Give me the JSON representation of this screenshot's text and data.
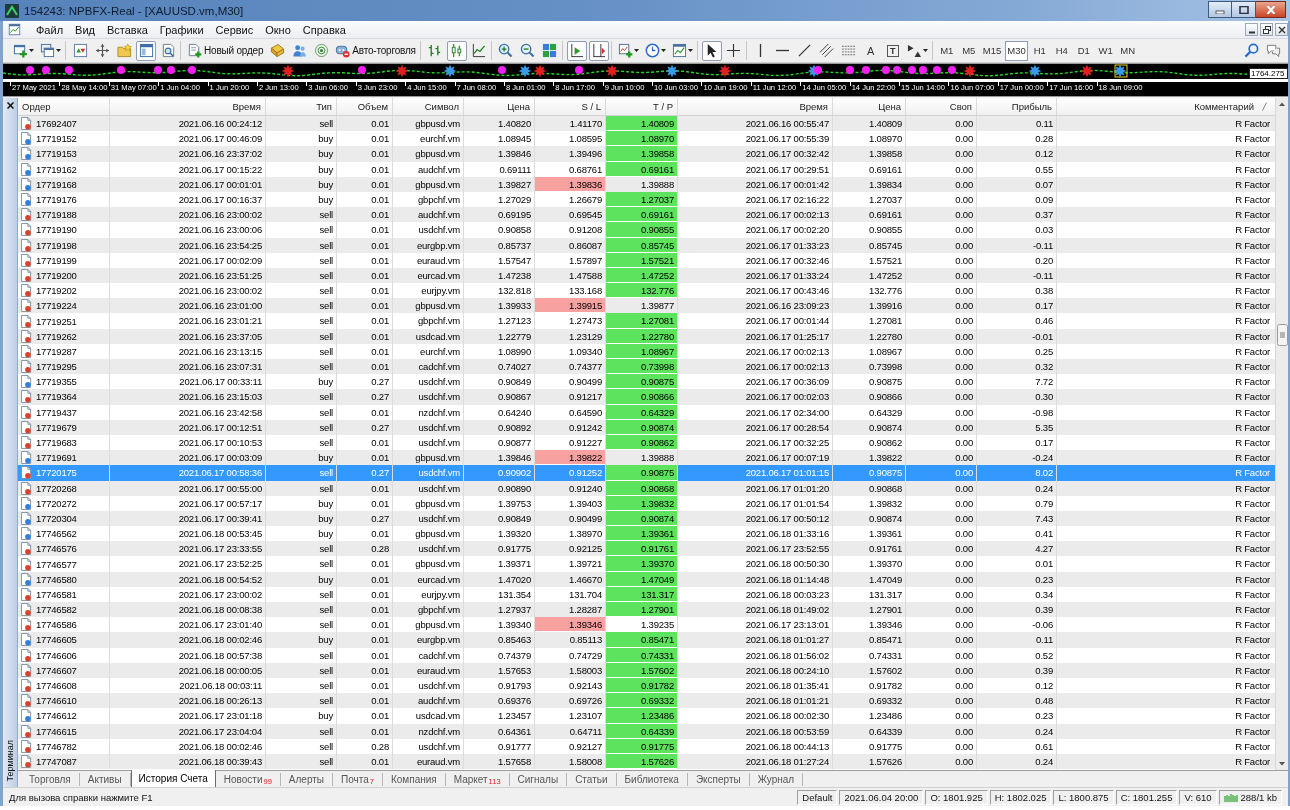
{
  "window": {
    "title": "154243: NPBFX-Real - [XAUUSD.vm,M30]"
  },
  "menu": [
    "Файл",
    "Вид",
    "Вставка",
    "Графики",
    "Сервис",
    "Окно",
    "Справка"
  ],
  "toolbar": {
    "groups": [
      [
        {
          "kind": "icon",
          "pressed": false,
          "dropdown": true
        },
        {
          "kind": "icon",
          "pressed": false,
          "dropdown": true
        }
      ],
      [
        {
          "kind": "icon",
          "pressed": false
        },
        {
          "kind": "icon",
          "pressed": false
        },
        {
          "kind": "icon",
          "pressed": false
        },
        {
          "kind": "icon",
          "pressed": true
        },
        {
          "kind": "icon",
          "pressed": false
        }
      ],
      [
        {
          "kind": "button",
          "label": "Новый ордер",
          "pressed": false
        },
        {
          "kind": "icon",
          "pressed": false
        },
        {
          "kind": "icon",
          "pressed": false
        },
        {
          "kind": "icon",
          "pressed": false
        },
        {
          "kind": "button",
          "label": "Авто-торговля",
          "pressed": false
        }
      ],
      [
        {
          "kind": "icon",
          "pressed": false
        },
        {
          "kind": "icon",
          "pressed": true
        },
        {
          "kind": "icon",
          "pressed": false
        }
      ],
      [
        {
          "kind": "icon",
          "pressed": false
        },
        {
          "kind": "icon",
          "pressed": false
        },
        {
          "kind": "icon",
          "pressed": false
        }
      ],
      [
        {
          "kind": "icon",
          "pressed": true
        },
        {
          "kind": "icon",
          "pressed": true
        }
      ],
      [
        {
          "kind": "icon",
          "pressed": false,
          "dropdown": true
        },
        {
          "kind": "icon",
          "pressed": false,
          "dropdown": true
        },
        {
          "kind": "icon",
          "pressed": false,
          "dropdown": true
        }
      ],
      [
        {
          "kind": "icon",
          "pressed": true
        },
        {
          "kind": "icon",
          "pressed": false
        }
      ],
      [
        {
          "kind": "icon",
          "pressed": false
        },
        {
          "kind": "icon",
          "pressed": false
        },
        {
          "kind": "icon",
          "pressed": false
        },
        {
          "kind": "icon",
          "pressed": false
        },
        {
          "kind": "icon",
          "pressed": false
        },
        {
          "kind": "glyph",
          "label": "A",
          "pressed": false
        },
        {
          "kind": "boxed_glyph",
          "label": "T",
          "pressed": false
        },
        {
          "kind": "icon",
          "pressed": false,
          "dropdown": true
        }
      ],
      [
        {
          "kind": "period",
          "label": "M1",
          "selected": false
        },
        {
          "kind": "period",
          "label": "M5",
          "selected": false
        },
        {
          "kind": "period",
          "label": "M15",
          "selected": false
        },
        {
          "kind": "period",
          "label": "M30",
          "selected": true
        },
        {
          "kind": "period",
          "label": "H1",
          "selected": false
        },
        {
          "kind": "period",
          "label": "H4",
          "selected": false
        },
        {
          "kind": "period",
          "label": "D1",
          "selected": false
        },
        {
          "kind": "period",
          "label": "W1",
          "selected": false
        },
        {
          "kind": "period",
          "label": "MN",
          "selected": false
        }
      ]
    ]
  },
  "chart": {
    "price_label": "1764.275",
    "time_labels": [
      "27 May 2021",
      "28 May 14:00",
      "31 May 07:00",
      "1 Jun 04:00",
      "1 Jun 20:00",
      "2 Jun 13:00",
      "3 Jun 06:00",
      "3 Jun 23:00",
      "4 Jun 15:00",
      "7 Jun 08:00",
      "8 Jun 01:00",
      "8 Jun 17:00",
      "9 Jun 10:00",
      "10 Jun 03:00",
      "10 Jun 19:00",
      "11 Jun 12:00",
      "14 Jun 05:00",
      "14 Jun 22:00",
      "15 Jun 14:00",
      "16 Jun 07:00",
      "17 Jun 00:00",
      "17 Jun 16:00",
      "18 Jun 09:00"
    ]
  },
  "terminal": {
    "caption": "Терминал",
    "columns": [
      "Ордер",
      "Время",
      "Тип",
      "Объем",
      "Символ",
      "Цена",
      "S / L",
      "T / P",
      "Время",
      "Цена",
      "Своп",
      "Прибыль",
      "Комментарий"
    ],
    "rows": [
      {
        "kind": "sell",
        "selected": false,
        "sl_hit": false,
        "tp_hit": true,
        "cells": [
          "17692407",
          "2021.06.16 00:24:12",
          "sell",
          "0.01",
          "gbpusd.vm",
          "1.40820",
          "1.41170",
          "1.40809",
          "2021.06.16 00:55:47",
          "1.40809",
          "0.00",
          "0.11",
          "R Factor"
        ]
      },
      {
        "kind": "buy",
        "selected": false,
        "sl_hit": false,
        "tp_hit": true,
        "cells": [
          "17719152",
          "2021.06.17 00:46:09",
          "buy",
          "0.01",
          "eurchf.vm",
          "1.08945",
          "1.08595",
          "1.08970",
          "2021.06.17 00:55:39",
          "1.08970",
          "0.00",
          "0.28",
          "R Factor"
        ]
      },
      {
        "kind": "buy",
        "selected": false,
        "sl_hit": false,
        "tp_hit": true,
        "cells": [
          "17719153",
          "2021.06.16 23:37:02",
          "buy",
          "0.01",
          "gbpusd.vm",
          "1.39846",
          "1.39496",
          "1.39858",
          "2021.06.17 00:32:42",
          "1.39858",
          "0.00",
          "0.12",
          "R Factor"
        ]
      },
      {
        "kind": "buy",
        "selected": false,
        "sl_hit": false,
        "tp_hit": true,
        "cells": [
          "17719162",
          "2021.06.17 00:15:22",
          "buy",
          "0.01",
          "audchf.vm",
          "0.69111",
          "0.68761",
          "0.69161",
          "2021.06.17 00:29:51",
          "0.69161",
          "0.00",
          "0.55",
          "R Factor"
        ]
      },
      {
        "kind": "buy",
        "selected": false,
        "sl_hit": true,
        "tp_hit": false,
        "cells": [
          "17719168",
          "2021.06.17 00:01:01",
          "buy",
          "0.01",
          "gbpusd.vm",
          "1.39827",
          "1.39836",
          "1.39888",
          "2021.06.17 00:01:42",
          "1.39834",
          "0.00",
          "0.07",
          "R Factor"
        ]
      },
      {
        "kind": "buy",
        "selected": false,
        "sl_hit": false,
        "tp_hit": true,
        "cells": [
          "17719176",
          "2021.06.17 00:16:37",
          "buy",
          "0.01",
          "gbpchf.vm",
          "1.27029",
          "1.26679",
          "1.27037",
          "2021.06.17 02:16:22",
          "1.27037",
          "0.00",
          "0.09",
          "R Factor"
        ]
      },
      {
        "kind": "sell",
        "selected": false,
        "sl_hit": false,
        "tp_hit": true,
        "cells": [
          "17719188",
          "2021.06.16 23:00:02",
          "sell",
          "0.01",
          "audchf.vm",
          "0.69195",
          "0.69545",
          "0.69161",
          "2021.06.17 00:02:13",
          "0.69161",
          "0.00",
          "0.37",
          "R Factor"
        ]
      },
      {
        "kind": "sell",
        "selected": false,
        "sl_hit": false,
        "tp_hit": true,
        "cells": [
          "17719190",
          "2021.06.16 23:00:06",
          "sell",
          "0.01",
          "usdchf.vm",
          "0.90858",
          "0.91208",
          "0.90855",
          "2021.06.17 00:02:20",
          "0.90855",
          "0.00",
          "0.03",
          "R Factor"
        ]
      },
      {
        "kind": "sell",
        "selected": false,
        "sl_hit": false,
        "tp_hit": true,
        "cells": [
          "17719198",
          "2021.06.16 23:54:25",
          "sell",
          "0.01",
          "eurgbp.vm",
          "0.85737",
          "0.86087",
          "0.85745",
          "2021.06.17 01:33:23",
          "0.85745",
          "0.00",
          "-0.11",
          "R Factor"
        ]
      },
      {
        "kind": "sell",
        "selected": false,
        "sl_hit": false,
        "tp_hit": true,
        "cells": [
          "17719199",
          "2021.06.17 00:02:09",
          "sell",
          "0.01",
          "euraud.vm",
          "1.57547",
          "1.57897",
          "1.57521",
          "2021.06.17 00:32:46",
          "1.57521",
          "0.00",
          "0.20",
          "R Factor"
        ]
      },
      {
        "kind": "sell",
        "selected": false,
        "sl_hit": false,
        "tp_hit": true,
        "cells": [
          "17719200",
          "2021.06.16 23:51:25",
          "sell",
          "0.01",
          "eurcad.vm",
          "1.47238",
          "1.47588",
          "1.47252",
          "2021.06.17 01:33:24",
          "1.47252",
          "0.00",
          "-0.11",
          "R Factor"
        ]
      },
      {
        "kind": "sell",
        "selected": false,
        "sl_hit": false,
        "tp_hit": true,
        "cells": [
          "17719202",
          "2021.06.16 23:00:02",
          "sell",
          "0.01",
          "eurjpy.vm",
          "132.818",
          "133.168",
          "132.776",
          "2021.06.17 00:43:46",
          "132.776",
          "0.00",
          "0.38",
          "R Factor"
        ]
      },
      {
        "kind": "sell",
        "selected": false,
        "sl_hit": true,
        "tp_hit": false,
        "cells": [
          "17719224",
          "2021.06.16 23:01:00",
          "sell",
          "0.01",
          "gbpusd.vm",
          "1.39933",
          "1.39915",
          "1.39877",
          "2021.06.16 23:09:23",
          "1.39916",
          "0.00",
          "0.17",
          "R Factor"
        ]
      },
      {
        "kind": "sell",
        "selected": false,
        "sl_hit": false,
        "tp_hit": true,
        "cells": [
          "17719251",
          "2021.06.16 23:01:21",
          "sell",
          "0.01",
          "gbpchf.vm",
          "1.27123",
          "1.27473",
          "1.27081",
          "2021.06.17 00:01:44",
          "1.27081",
          "0.00",
          "0.46",
          "R Factor"
        ]
      },
      {
        "kind": "sell",
        "selected": false,
        "sl_hit": false,
        "tp_hit": true,
        "cells": [
          "17719262",
          "2021.06.16 23:37:05",
          "sell",
          "0.01",
          "usdcad.vm",
          "1.22779",
          "1.23129",
          "1.22780",
          "2021.06.17 01:25:17",
          "1.22780",
          "0.00",
          "-0.01",
          "R Factor"
        ]
      },
      {
        "kind": "sell",
        "selected": false,
        "sl_hit": false,
        "tp_hit": true,
        "cells": [
          "17719287",
          "2021.06.16 23:13:15",
          "sell",
          "0.01",
          "eurchf.vm",
          "1.08990",
          "1.09340",
          "1.08967",
          "2021.06.17 00:02:13",
          "1.08967",
          "0.00",
          "0.25",
          "R Factor"
        ]
      },
      {
        "kind": "sell",
        "selected": false,
        "sl_hit": false,
        "tp_hit": true,
        "cells": [
          "17719295",
          "2021.06.16 23:07:31",
          "sell",
          "0.01",
          "cadchf.vm",
          "0.74027",
          "0.74377",
          "0.73998",
          "2021.06.17 00:02:13",
          "0.73998",
          "0.00",
          "0.32",
          "R Factor"
        ]
      },
      {
        "kind": "buy",
        "selected": false,
        "sl_hit": false,
        "tp_hit": true,
        "cells": [
          "17719355",
          "2021.06.17 00:33:11",
          "buy",
          "0.27",
          "usdchf.vm",
          "0.90849",
          "0.90499",
          "0.90875",
          "2021.06.17 00:36:09",
          "0.90875",
          "0.00",
          "7.72",
          "R Factor"
        ]
      },
      {
        "kind": "sell",
        "selected": false,
        "sl_hit": false,
        "tp_hit": true,
        "cells": [
          "17719364",
          "2021.06.16 23:15:03",
          "sell",
          "0.27",
          "usdchf.vm",
          "0.90867",
          "0.91217",
          "0.90866",
          "2021.06.17 00:02:03",
          "0.90866",
          "0.00",
          "0.30",
          "R Factor"
        ]
      },
      {
        "kind": "sell",
        "selected": false,
        "sl_hit": false,
        "tp_hit": true,
        "cells": [
          "17719437",
          "2021.06.16 23:42:58",
          "sell",
          "0.01",
          "nzdchf.vm",
          "0.64240",
          "0.64590",
          "0.64329",
          "2021.06.17 02:34:00",
          "0.64329",
          "0.00",
          "-0.98",
          "R Factor"
        ]
      },
      {
        "kind": "sell",
        "selected": false,
        "sl_hit": false,
        "tp_hit": true,
        "cells": [
          "17719679",
          "2021.06.17 00:12:51",
          "sell",
          "0.27",
          "usdchf.vm",
          "0.90892",
          "0.91242",
          "0.90874",
          "2021.06.17 00:28:54",
          "0.90874",
          "0.00",
          "5.35",
          "R Factor"
        ]
      },
      {
        "kind": "sell",
        "selected": false,
        "sl_hit": false,
        "tp_hit": true,
        "cells": [
          "17719683",
          "2021.06.17 00:10:53",
          "sell",
          "0.01",
          "usdchf.vm",
          "0.90877",
          "0.91227",
          "0.90862",
          "2021.06.17 00:32:25",
          "0.90862",
          "0.00",
          "0.17",
          "R Factor"
        ]
      },
      {
        "kind": "buy",
        "selected": false,
        "sl_hit": true,
        "tp_hit": false,
        "cells": [
          "17719691",
          "2021.06.17 00:03:09",
          "buy",
          "0.01",
          "gbpusd.vm",
          "1.39846",
          "1.39822",
          "1.39888",
          "2021.06.17 00:07:19",
          "1.39822",
          "0.00",
          "-0.24",
          "R Factor"
        ]
      },
      {
        "kind": "sell",
        "selected": true,
        "sl_hit": false,
        "tp_hit": true,
        "cells": [
          "17720175",
          "2021.06.17 00:58:36",
          "sell",
          "0.27",
          "usdchf.vm",
          "0.90902",
          "0.91252",
          "0.90875",
          "2021.06.17 01:01:15",
          "0.90875",
          "0.00",
          "8.02",
          "R Factor"
        ]
      },
      {
        "kind": "sell",
        "selected": false,
        "sl_hit": false,
        "tp_hit": true,
        "cells": [
          "17720268",
          "2021.06.17 00:55:00",
          "sell",
          "0.01",
          "usdchf.vm",
          "0.90890",
          "0.91240",
          "0.90868",
          "2021.06.17 01:01:20",
          "0.90868",
          "0.00",
          "0.24",
          "R Factor"
        ]
      },
      {
        "kind": "buy",
        "selected": false,
        "sl_hit": false,
        "tp_hit": true,
        "cells": [
          "17720272",
          "2021.06.17 00:57:17",
          "buy",
          "0.01",
          "gbpusd.vm",
          "1.39753",
          "1.39403",
          "1.39832",
          "2021.06.17 01:01:54",
          "1.39832",
          "0.00",
          "0.79",
          "R Factor"
        ]
      },
      {
        "kind": "buy",
        "selected": false,
        "sl_hit": false,
        "tp_hit": true,
        "cells": [
          "17720304",
          "2021.06.17 00:39:41",
          "buy",
          "0.27",
          "usdchf.vm",
          "0.90849",
          "0.90499",
          "0.90874",
          "2021.06.17 00:50:12",
          "0.90874",
          "0.00",
          "7.43",
          "R Factor"
        ]
      },
      {
        "kind": "buy",
        "selected": false,
        "sl_hit": false,
        "tp_hit": true,
        "cells": [
          "17746562",
          "2021.06.18 00:53:45",
          "buy",
          "0.01",
          "gbpusd.vm",
          "1.39320",
          "1.38970",
          "1.39361",
          "2021.06.18 01:33:16",
          "1.39361",
          "0.00",
          "0.41",
          "R Factor"
        ]
      },
      {
        "kind": "sell",
        "selected": false,
        "sl_hit": false,
        "tp_hit": true,
        "cells": [
          "17746576",
          "2021.06.17 23:33:55",
          "sell",
          "0.28",
          "usdchf.vm",
          "0.91775",
          "0.92125",
          "0.91761",
          "2021.06.17 23:52:55",
          "0.91761",
          "0.00",
          "4.27",
          "R Factor"
        ]
      },
      {
        "kind": "sell",
        "selected": false,
        "sl_hit": false,
        "tp_hit": true,
        "cells": [
          "17746577",
          "2021.06.17 23:52:25",
          "sell",
          "0.01",
          "gbpusd.vm",
          "1.39371",
          "1.39721",
          "1.39370",
          "2021.06.18 00:50:30",
          "1.39370",
          "0.00",
          "0.01",
          "R Factor"
        ]
      },
      {
        "kind": "buy",
        "selected": false,
        "sl_hit": false,
        "tp_hit": true,
        "cells": [
          "17746580",
          "2021.06.18 00:54:52",
          "buy",
          "0.01",
          "eurcad.vm",
          "1.47020",
          "1.46670",
          "1.47049",
          "2021.06.18 01:14:48",
          "1.47049",
          "0.00",
          "0.23",
          "R Factor"
        ]
      },
      {
        "kind": "sell",
        "selected": false,
        "sl_hit": false,
        "tp_hit": true,
        "cells": [
          "17746581",
          "2021.06.17 23:00:02",
          "sell",
          "0.01",
          "eurjpy.vm",
          "131.354",
          "131.704",
          "131.317",
          "2021.06.18 00:03:23",
          "131.317",
          "0.00",
          "0.34",
          "R Factor"
        ]
      },
      {
        "kind": "sell",
        "selected": false,
        "sl_hit": false,
        "tp_hit": true,
        "cells": [
          "17746582",
          "2021.06.18 00:08:38",
          "sell",
          "0.01",
          "gbpchf.vm",
          "1.27937",
          "1.28287",
          "1.27901",
          "2021.06.18 01:49:02",
          "1.27901",
          "0.00",
          "0.39",
          "R Factor"
        ]
      },
      {
        "kind": "sell",
        "selected": false,
        "sl_hit": true,
        "tp_hit": false,
        "cells": [
          "17746586",
          "2021.06.17 23:01:40",
          "sell",
          "0.01",
          "gbpusd.vm",
          "1.39340",
          "1.39346",
          "1.39235",
          "2021.06.17 23:13:01",
          "1.39346",
          "0.00",
          "-0.06",
          "R Factor"
        ]
      },
      {
        "kind": "buy",
        "selected": false,
        "sl_hit": false,
        "tp_hit": true,
        "cells": [
          "17746605",
          "2021.06.18 00:02:46",
          "buy",
          "0.01",
          "eurgbp.vm",
          "0.85463",
          "0.85113",
          "0.85471",
          "2021.06.18 01:01:27",
          "0.85471",
          "0.00",
          "0.11",
          "R Factor"
        ]
      },
      {
        "kind": "sell",
        "selected": false,
        "sl_hit": false,
        "tp_hit": true,
        "cells": [
          "17746606",
          "2021.06.18 00:57:38",
          "sell",
          "0.01",
          "cadchf.vm",
          "0.74379",
          "0.74729",
          "0.74331",
          "2021.06.18 01:56:02",
          "0.74331",
          "0.00",
          "0.52",
          "R Factor"
        ]
      },
      {
        "kind": "sell",
        "selected": false,
        "sl_hit": false,
        "tp_hit": true,
        "cells": [
          "17746607",
          "2021.06.18 00:00:05",
          "sell",
          "0.01",
          "euraud.vm",
          "1.57653",
          "1.58003",
          "1.57602",
          "2021.06.18 00:24:10",
          "1.57602",
          "0.00",
          "0.39",
          "R Factor"
        ]
      },
      {
        "kind": "sell",
        "selected": false,
        "sl_hit": false,
        "tp_hit": true,
        "cells": [
          "17746608",
          "2021.06.18 00:03:11",
          "sell",
          "0.01",
          "usdchf.vm",
          "0.91793",
          "0.92143",
          "0.91782",
          "2021.06.18 01:35:41",
          "0.91782",
          "0.00",
          "0.12",
          "R Factor"
        ]
      },
      {
        "kind": "sell",
        "selected": false,
        "sl_hit": false,
        "tp_hit": true,
        "cells": [
          "17746610",
          "2021.06.18 00:26:13",
          "sell",
          "0.01",
          "audchf.vm",
          "0.69376",
          "0.69726",
          "0.69332",
          "2021.06.18 01:01:21",
          "0.69332",
          "0.00",
          "0.48",
          "R Factor"
        ]
      },
      {
        "kind": "buy",
        "selected": false,
        "sl_hit": false,
        "tp_hit": true,
        "cells": [
          "17746612",
          "2021.06.17 23:01:18",
          "buy",
          "0.01",
          "usdcad.vm",
          "1.23457",
          "1.23107",
          "1.23486",
          "2021.06.18 00:02:30",
          "1.23486",
          "0.00",
          "0.23",
          "R Factor"
        ]
      },
      {
        "kind": "sell",
        "selected": false,
        "sl_hit": false,
        "tp_hit": true,
        "cells": [
          "17746615",
          "2021.06.17 23:04:04",
          "sell",
          "0.01",
          "nzdchf.vm",
          "0.64361",
          "0.64711",
          "0.64339",
          "2021.06.18 00:53:59",
          "0.64339",
          "0.00",
          "0.24",
          "R Factor"
        ]
      },
      {
        "kind": "sell",
        "selected": false,
        "sl_hit": false,
        "tp_hit": true,
        "cells": [
          "17746782",
          "2021.06.18 00:02:46",
          "sell",
          "0.28",
          "usdchf.vm",
          "0.91777",
          "0.92127",
          "0.91775",
          "2021.06.18 00:44:13",
          "0.91775",
          "0.00",
          "0.61",
          "R Factor"
        ]
      },
      {
        "kind": "sell",
        "selected": false,
        "sl_hit": false,
        "tp_hit": true,
        "cells": [
          "17747087",
          "2021.06.18 00:39:43",
          "sell",
          "0.01",
          "euraud.vm",
          "1.57658",
          "1.58008",
          "1.57626",
          "2021.06.18 01:27:24",
          "1.57626",
          "0.00",
          "0.24",
          "R Factor"
        ]
      }
    ],
    "tabs": [
      {
        "label": "Торговля",
        "selected": false
      },
      {
        "label": "Активы",
        "selected": false
      },
      {
        "label": "История Счета",
        "selected": true
      },
      {
        "label": "Новости",
        "badge": "99",
        "selected": false
      },
      {
        "label": "Алерты",
        "selected": false
      },
      {
        "label": "Почта",
        "badge": "7",
        "selected": false
      },
      {
        "label": "Компания",
        "selected": false
      },
      {
        "label": "Маркет",
        "badge": "113",
        "selected": false
      },
      {
        "label": "Сигналы",
        "selected": false
      },
      {
        "label": "Статьи",
        "selected": false
      },
      {
        "label": "Библиотека",
        "selected": false
      },
      {
        "label": "Эксперты",
        "selected": false
      },
      {
        "label": "Журнал",
        "selected": false
      }
    ]
  },
  "status_bar": {
    "help": "Для вызова справки нажмите F1",
    "fields": [
      "Default",
      "2021.06.04 20:00",
      "O: 1801.925",
      "H: 1802.025",
      "L: 1800.875",
      "C: 1801.255",
      "V: 610"
    ],
    "traffic": "288/1 kb"
  }
}
